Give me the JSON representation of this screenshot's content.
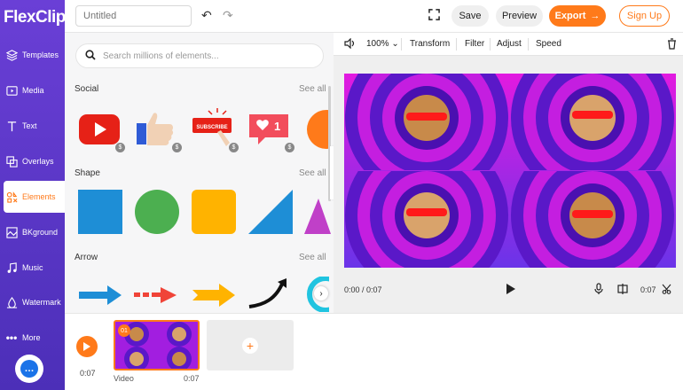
{
  "app": {
    "logo": "FlexClip"
  },
  "sidebar": {
    "items": [
      {
        "label": "Templates",
        "icon": "layers-icon"
      },
      {
        "label": "Media",
        "icon": "media-icon"
      },
      {
        "label": "Text",
        "icon": "text-icon"
      },
      {
        "label": "Overlays",
        "icon": "overlays-icon"
      },
      {
        "label": "Elements",
        "icon": "elements-icon",
        "active": true
      },
      {
        "label": "BKground",
        "icon": "background-icon"
      },
      {
        "label": "Music",
        "icon": "music-icon"
      },
      {
        "label": "Watermark",
        "icon": "watermark-icon"
      },
      {
        "label": "More",
        "icon": "more-icon"
      }
    ]
  },
  "topbar": {
    "title_placeholder": "Untitled",
    "save": "Save",
    "preview": "Preview",
    "export": "Export",
    "signup": "Sign Up"
  },
  "panel": {
    "search_placeholder": "Search millions of elements...",
    "sections": [
      {
        "title": "Social",
        "see_all": "See all"
      },
      {
        "title": "Shape",
        "see_all": "See all"
      },
      {
        "title": "Arrow",
        "see_all": "See all"
      }
    ],
    "social_items": [
      "youtube-logo",
      "thumbs-up",
      "subscribe-button",
      "like-notification"
    ],
    "subscribe_text": "SUBSCRIBE",
    "like_count": "1"
  },
  "preview": {
    "toolbar": {
      "zoom": "100%",
      "transform": "Transform",
      "filter": "Filter",
      "adjust": "Adjust",
      "speed": "Speed"
    },
    "time_current": "0:00 / 0:07",
    "time_total": "0:07"
  },
  "timeline": {
    "time": "0:07",
    "clip_number": "01",
    "clip_label": "Video",
    "clip_duration": "0:07"
  },
  "colors": {
    "sidebar": "#5a35c8",
    "accent": "#ff7a1a",
    "canvas_magenta": "#e61ad8",
    "canvas_purple": "#6a1bd6"
  }
}
